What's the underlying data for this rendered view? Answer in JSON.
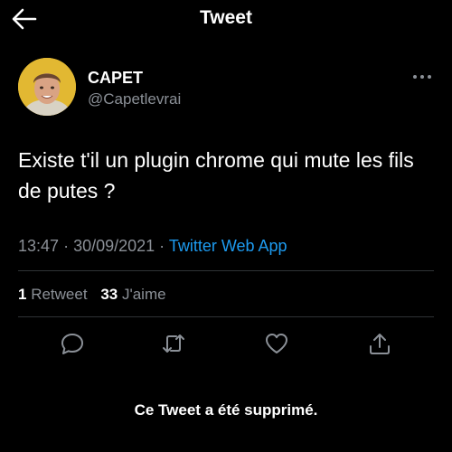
{
  "header": {
    "title": "Tweet",
    "back_icon": "arrow-left-icon"
  },
  "author": {
    "display_name": "CAPET",
    "handle": "@Capetlevrai",
    "more_icon": "more-horizontal-icon"
  },
  "tweet": {
    "text": "Existe t'il un plugin chrome qui mute les fils de putes ?",
    "time": "13:47",
    "date": "30/09/2021",
    "source": "Twitter Web App"
  },
  "stats": {
    "retweets_count": "1",
    "retweets_label": "Retweet",
    "likes_count": "33",
    "likes_label": "J'aime"
  },
  "actions": [
    "reply-icon",
    "retweet-icon",
    "like-icon",
    "share-icon"
  ],
  "footer": {
    "deleted_notice": "Ce Tweet a été supprimé."
  },
  "colors": {
    "background": "#000000",
    "text": "#ffffff",
    "secondary": "#8b9097",
    "accent": "#1d9bf0",
    "divider": "#2f3336"
  }
}
